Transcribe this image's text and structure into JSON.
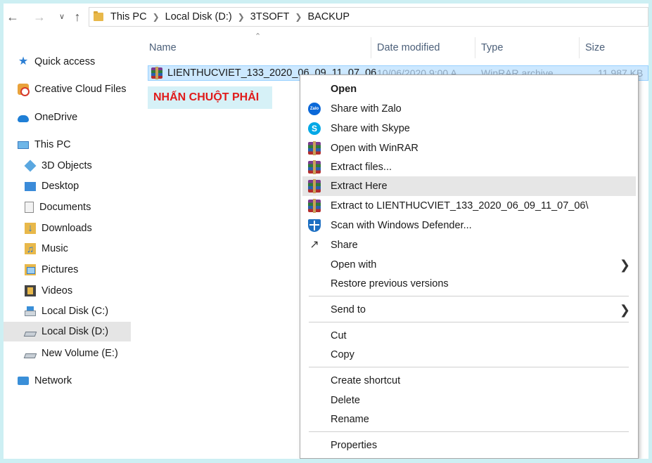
{
  "address_bar": {
    "breadcrumbs": [
      "This PC",
      "Local Disk (D:)",
      "3TSOFT",
      "BACKUP"
    ]
  },
  "sidebar": {
    "items": [
      {
        "label": "Quick access",
        "icon": "star-icon"
      },
      {
        "label": "Creative Cloud Files",
        "icon": "creative-cloud-icon"
      },
      {
        "label": "OneDrive",
        "icon": "cloud-icon"
      },
      {
        "label": "This PC",
        "icon": "computer-icon"
      },
      {
        "label": "3D Objects",
        "icon": "3d-objects-icon"
      },
      {
        "label": "Desktop",
        "icon": "desktop-icon"
      },
      {
        "label": "Documents",
        "icon": "documents-icon"
      },
      {
        "label": "Downloads",
        "icon": "downloads-icon"
      },
      {
        "label": "Music",
        "icon": "music-icon"
      },
      {
        "label": "Pictures",
        "icon": "pictures-icon"
      },
      {
        "label": "Videos",
        "icon": "videos-icon"
      },
      {
        "label": "Local Disk (C:)",
        "icon": "system-drive-icon"
      },
      {
        "label": "Local Disk (D:)",
        "icon": "drive-icon"
      },
      {
        "label": "New Volume (E:)",
        "icon": "drive-icon"
      },
      {
        "label": "Network",
        "icon": "network-icon"
      }
    ],
    "selected": "Local Disk (D:)"
  },
  "columns": {
    "name": "Name",
    "date": "Date modified",
    "type": "Type",
    "size": "Size"
  },
  "file": {
    "name": "LIENTHUCVIET_133_2020_06_09_11_07_06",
    "date": "10/06/2020 9:00 A",
    "type": "WinRAR archive",
    "size": "11,987 KB"
  },
  "annotation": {
    "text": "NHẤN CHUỘT PHẢI",
    "color": "#e01b1b"
  },
  "context_menu": {
    "items": [
      {
        "label": "Open",
        "icon": ""
      },
      {
        "label": "Share with Zalo",
        "icon": "zalo-icon"
      },
      {
        "label": "Share with Skype",
        "icon": "skype-icon"
      },
      {
        "label": "Open with WinRAR",
        "icon": "winrar-icon"
      },
      {
        "label": "Extract files...",
        "icon": "winrar-icon"
      },
      {
        "label": "Extract Here",
        "icon": "winrar-icon"
      },
      {
        "label": "Extract to LIENTHUCVIET_133_2020_06_09_11_07_06\\",
        "icon": "winrar-icon"
      },
      {
        "label": "Scan with Windows Defender...",
        "icon": "windows-defender-icon"
      },
      {
        "label": "Share",
        "icon": "share-icon"
      },
      {
        "label": "Open with",
        "icon": ""
      },
      {
        "label": "Restore previous versions",
        "icon": ""
      },
      {
        "label": "Send to",
        "icon": ""
      },
      {
        "label": "Cut",
        "icon": ""
      },
      {
        "label": "Copy",
        "icon": ""
      },
      {
        "label": "Create shortcut",
        "icon": ""
      },
      {
        "label": "Delete",
        "icon": ""
      },
      {
        "label": "Rename",
        "icon": ""
      },
      {
        "label": "Properties",
        "icon": ""
      }
    ],
    "highlighted": "Extract Here"
  },
  "colors": {
    "background": "#cdeff3",
    "selection": "#cce8ff",
    "menu_highlight": "#e6e6e6",
    "arrow_fill": "#ffe21a",
    "arrow_stroke": "#d63a1a"
  }
}
